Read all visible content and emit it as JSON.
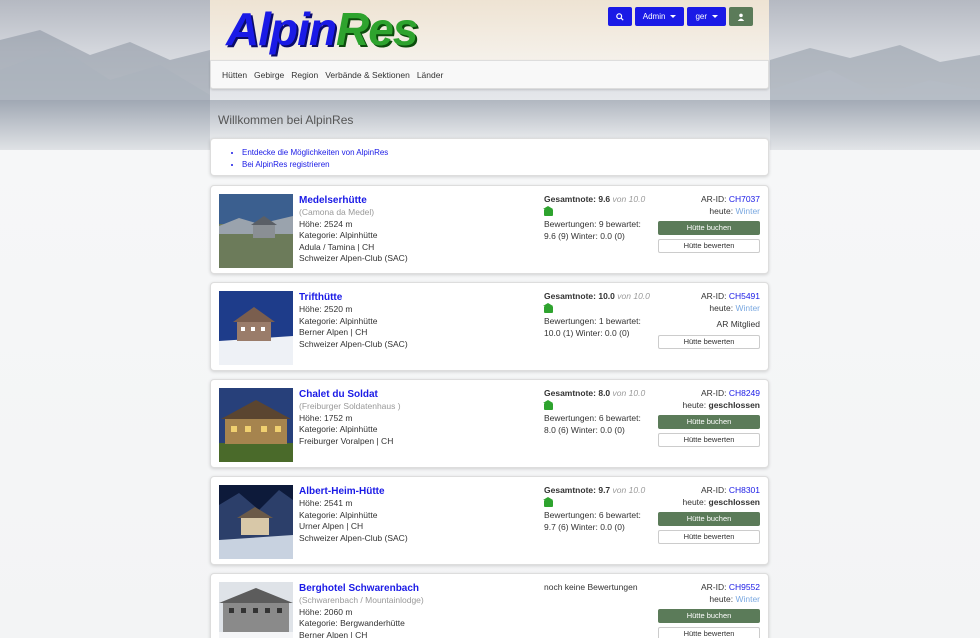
{
  "header": {
    "logo_part1": "Alpin",
    "logo_part2": "Res",
    "search_label": "",
    "admin_label": "Admin",
    "lang_label": "ger",
    "user_label": ""
  },
  "nav": [
    "Hütten",
    "Gebirge",
    "Region",
    "Verbände & Sektionen",
    "Länder"
  ],
  "welcome": "Willkommen bei AlpinRes",
  "links": [
    "Entdecke die Möglichkeiten von AlpinRes",
    "Bei AlpinRes registrieren"
  ],
  "labels": {
    "gesamtnote": "Gesamtnote:",
    "von": "von",
    "ar_id": "AR-ID:",
    "heute": "heute:",
    "book": "Hütte buchen",
    "rate": "Hütte bewerten"
  },
  "huts": [
    {
      "name": "Medelserhütte",
      "alt": "(Camona da Medel)",
      "height": "Höhe: 2524 m",
      "category": "Kategorie: Alpinhütte",
      "region": "Adula / Tamina | CH",
      "club": "Schweizer Alpen-Club (SAC)",
      "score": "9.6",
      "scale": "10.0",
      "reviews": "Bewertungen: 9 bewartet:",
      "detail": "9.6 (9) Winter: 0.0 (0)",
      "id": "CH7037",
      "status": "Winter",
      "status_type": "winter",
      "mitglied": ""
    },
    {
      "name": "Trifthütte",
      "alt": "",
      "height": "Höhe: 2520 m",
      "category": "Kategorie: Alpinhütte",
      "region": "Berner Alpen | CH",
      "club": "Schweizer Alpen-Club (SAC)",
      "score": "10.0",
      "scale": "10.0",
      "reviews": "Bewertungen: 1 bewartet:",
      "detail": "10.0 (1) Winter: 0.0 (0)",
      "id": "CH5491",
      "status": "Winter",
      "status_type": "winter",
      "mitglied": "AR Mitglied"
    },
    {
      "name": "Chalet du Soldat",
      "alt": "(Freiburger Soldatenhaus )",
      "height": "Höhe: 1752 m",
      "category": "Kategorie: Alpinhütte",
      "region": "Freiburger Voralpen | CH",
      "club": "",
      "score": "8.0",
      "scale": "10.0",
      "reviews": "Bewertungen: 6 bewartet:",
      "detail": "8.0 (6) Winter: 0.0 (0)",
      "id": "CH8249",
      "status": "geschlossen",
      "status_type": "closed",
      "mitglied": ""
    },
    {
      "name": "Albert-Heim-Hütte",
      "alt": "",
      "height": "Höhe: 2541 m",
      "category": "Kategorie: Alpinhütte",
      "region": "Urner Alpen | CH",
      "club": "Schweizer Alpen-Club (SAC)",
      "score": "9.7",
      "scale": "10.0",
      "reviews": "Bewertungen: 6 bewartet:",
      "detail": "9.7 (6) Winter: 0.0 (0)",
      "id": "CH8301",
      "status": "geschlossen",
      "status_type": "closed",
      "mitglied": ""
    },
    {
      "name": "Berghotel Schwarenbach",
      "alt": "(Schwarenbach / Mountainlodge)",
      "height": "Höhe: 2060 m",
      "category": "Kategorie: Bergwanderhütte",
      "region": "Berner Alpen | CH",
      "club": "",
      "no_reviews": "noch keine Bewertungen",
      "id": "CH9552",
      "status": "Winter",
      "status_type": "winter",
      "mitglied": ""
    }
  ]
}
